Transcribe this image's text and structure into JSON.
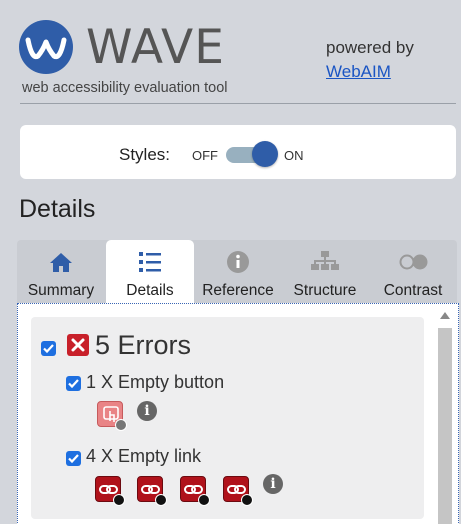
{
  "header": {
    "brand": "WAVE",
    "tagline": "web accessibility evaluation tool",
    "powered_by": "powered by",
    "webaim_link": "WebAIM",
    "logo_icon": "wave-logo-icon"
  },
  "styles": {
    "label": "Styles:",
    "off": "OFF",
    "on": "ON",
    "enabled": true
  },
  "details_heading": "Details",
  "tabs": [
    {
      "label": "Summary",
      "icon": "home-icon",
      "active": false
    },
    {
      "label": "Details",
      "icon": "list-icon",
      "active": true
    },
    {
      "label": "Reference",
      "icon": "info-icon",
      "active": false
    },
    {
      "label": "Structure",
      "icon": "hierarchy-icon",
      "active": false
    },
    {
      "label": "Contrast",
      "icon": "contrast-icon",
      "active": false
    }
  ],
  "errors": {
    "count_label": "5 Errors",
    "checked": true,
    "items": [
      {
        "label": "1 X Empty button",
        "checked": true,
        "instances": 1,
        "icon": "empty-button-icon"
      },
      {
        "label": "4 X Empty link",
        "checked": true,
        "instances": 4,
        "icon": "empty-link-icon"
      }
    ]
  },
  "colors": {
    "accent": "#2f5da8",
    "error": "#c8202a",
    "checkbox": "#1e6fe0"
  }
}
